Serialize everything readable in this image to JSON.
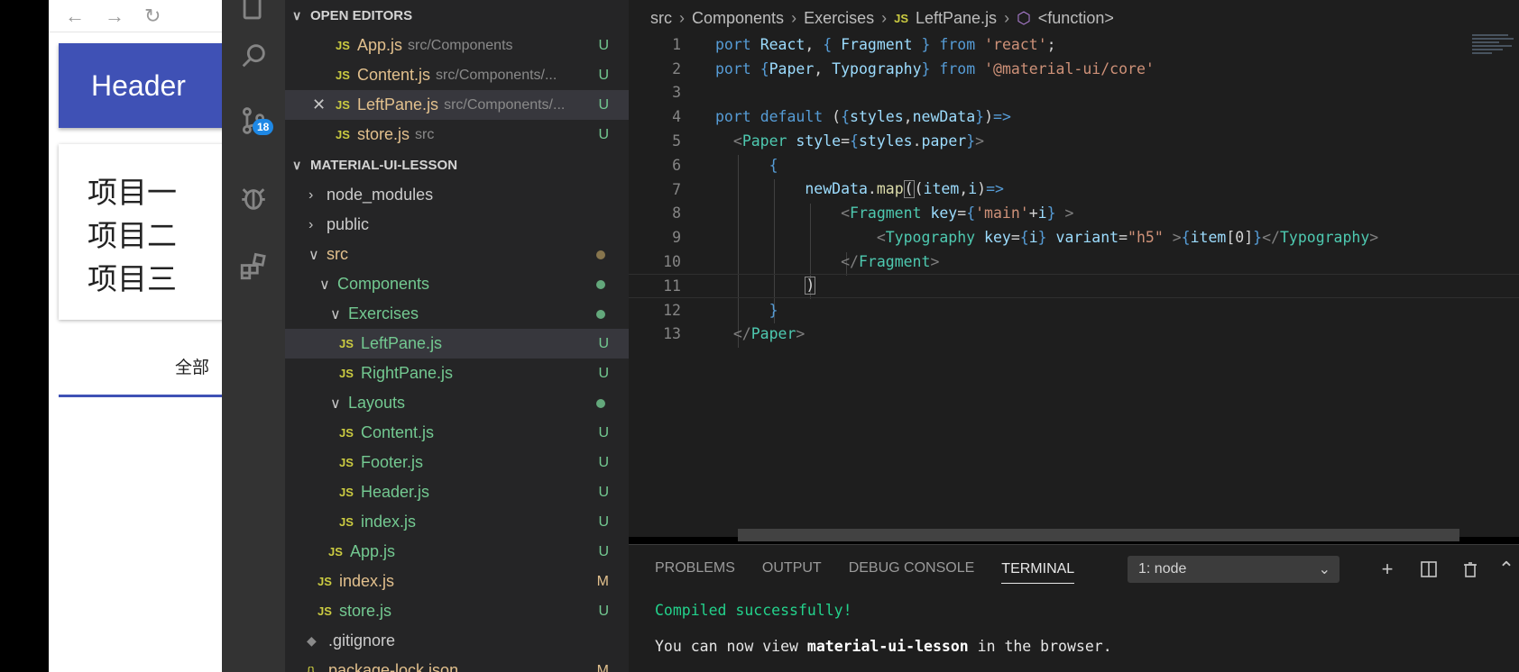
{
  "browser": {
    "header_title": "Header",
    "items": [
      "项目一",
      "项目二",
      "项目三"
    ],
    "tab_label": "全部"
  },
  "activity": {
    "scm_badge": "18"
  },
  "explorer": {
    "open_editors_title": "OPEN EDITORS",
    "open_editors": [
      {
        "name": "App.js",
        "path": "src/Components",
        "status": "U"
      },
      {
        "name": "Content.js",
        "path": "src/Components/...",
        "status": "U"
      },
      {
        "name": "LeftPane.js",
        "path": "src/Components/...",
        "status": "U"
      },
      {
        "name": "store.js",
        "path": "src",
        "status": "U"
      }
    ],
    "project_title": "MATERIAL-UI-LESSON",
    "tree": [
      {
        "name": "node_modules"
      },
      {
        "name": "public"
      },
      {
        "name": "src"
      },
      {
        "name": "Components"
      },
      {
        "name": "Exercises"
      },
      {
        "name": "LeftPane.js",
        "status": "U"
      },
      {
        "name": "RightPane.js",
        "status": "U"
      },
      {
        "name": "Layouts"
      },
      {
        "name": "Content.js",
        "status": "U"
      },
      {
        "name": "Footer.js",
        "status": "U"
      },
      {
        "name": "Header.js",
        "status": "U"
      },
      {
        "name": "index.js",
        "status": "U"
      },
      {
        "name": "App.js",
        "status": "U"
      },
      {
        "name": "index.js",
        "status": "M"
      },
      {
        "name": "store.js",
        "status": "U"
      },
      {
        "name": ".gitignore"
      },
      {
        "name": "package-lock.json",
        "status": "M"
      }
    ]
  },
  "editor": {
    "breadcrumb": [
      "src",
      "Components",
      "Exercises",
      "LeftPane.js",
      "<function>"
    ],
    "line_numbers": [
      "1",
      "2",
      "3",
      "4",
      "5",
      "6",
      "7",
      "8",
      "9",
      "10",
      "11",
      "12",
      "13"
    ]
  },
  "panel": {
    "tabs": [
      "PROBLEMS",
      "OUTPUT",
      "DEBUG CONSOLE",
      "TERMINAL"
    ],
    "terminal_select": "1: node",
    "terminal_lines": {
      "ok": "Compiled successfully!",
      "view_prefix": "You can now view ",
      "view_app": "material-ui-lesson",
      "view_suffix": " in the browser."
    }
  },
  "colors": {
    "accent_blue": "#3f51b5",
    "untracked_green": "#73c991",
    "modified_yellow": "#e2c08d",
    "js_icon": "#cbcb41"
  }
}
